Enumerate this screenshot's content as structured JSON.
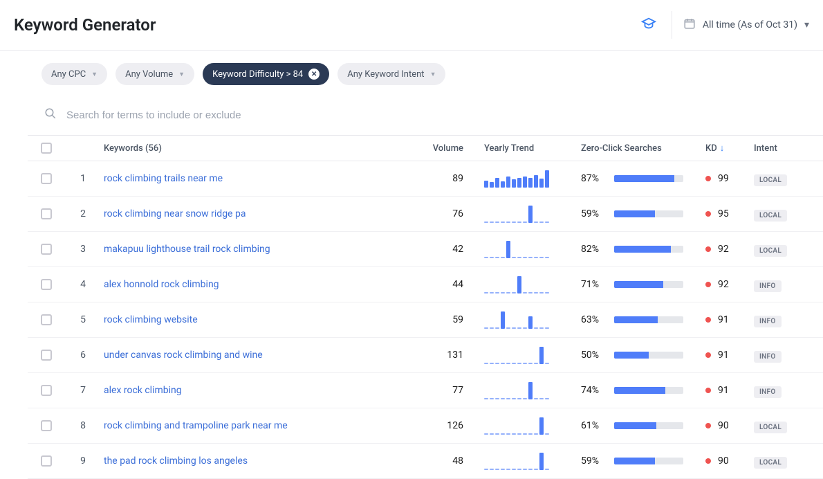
{
  "header": {
    "title": "Keyword Generator",
    "date_range": "All time (As of Oct 31)"
  },
  "filters": {
    "cpc": "Any CPC",
    "volume": "Any Volume",
    "difficulty": "Keyword Difficulty > 84",
    "intent": "Any Keyword Intent"
  },
  "search": {
    "placeholder": "Search for terms to include or exclude"
  },
  "columns": {
    "keywords": "Keywords (56)",
    "volume": "Volume",
    "trend": "Yearly Trend",
    "zero": "Zero-Click Searches",
    "kd": "KD",
    "intent": "Intent"
  },
  "rows": [
    {
      "n": 1,
      "keyword": "rock climbing trails near me",
      "volume": 89,
      "zero_pct": 87,
      "kd": 99,
      "intent": "LOCAL",
      "trend": [
        40,
        30,
        52,
        35,
        60,
        48,
        52,
        60,
        55,
        70,
        50,
        95
      ]
    },
    {
      "n": 2,
      "keyword": "rock climbing near snow ridge pa",
      "volume": 76,
      "zero_pct": 59,
      "kd": 95,
      "intent": "LOCAL",
      "trend": [
        0,
        0,
        0,
        0,
        0,
        0,
        0,
        0,
        95,
        0,
        0,
        0
      ]
    },
    {
      "n": 3,
      "keyword": "makapuu lighthouse trail rock climbing",
      "volume": 42,
      "zero_pct": 82,
      "kd": 92,
      "intent": "LOCAL",
      "trend": [
        0,
        0,
        0,
        0,
        95,
        0,
        0,
        0,
        0,
        0,
        0,
        0
      ]
    },
    {
      "n": 4,
      "keyword": "alex honnold rock climbing",
      "volume": 44,
      "zero_pct": 71,
      "kd": 92,
      "intent": "INFO",
      "trend": [
        0,
        0,
        0,
        0,
        0,
        0,
        95,
        0,
        0,
        0,
        0,
        0
      ]
    },
    {
      "n": 5,
      "keyword": "rock climbing website",
      "volume": 59,
      "zero_pct": 63,
      "kd": 91,
      "intent": "INFO",
      "trend": [
        0,
        0,
        0,
        95,
        0,
        0,
        0,
        0,
        70,
        0,
        0,
        0
      ]
    },
    {
      "n": 6,
      "keyword": "under canvas rock climbing and wine",
      "volume": 131,
      "zero_pct": 50,
      "kd": 91,
      "intent": "INFO",
      "trend": [
        0,
        0,
        0,
        0,
        0,
        0,
        0,
        0,
        0,
        0,
        95,
        0
      ]
    },
    {
      "n": 7,
      "keyword": "alex rock climbing",
      "volume": 77,
      "zero_pct": 74,
      "kd": 91,
      "intent": "INFO",
      "trend": [
        0,
        0,
        0,
        0,
        0,
        0,
        0,
        0,
        95,
        0,
        0,
        0
      ]
    },
    {
      "n": 8,
      "keyword": "rock climbing and trampoline park near me",
      "volume": 126,
      "zero_pct": 61,
      "kd": 90,
      "intent": "LOCAL",
      "trend": [
        0,
        0,
        0,
        0,
        0,
        0,
        0,
        0,
        0,
        0,
        95,
        0
      ]
    },
    {
      "n": 9,
      "keyword": "the pad rock climbing los angeles",
      "volume": 48,
      "zero_pct": 59,
      "kd": 90,
      "intent": "LOCAL",
      "trend": [
        0,
        0,
        0,
        0,
        0,
        0,
        0,
        0,
        0,
        0,
        95,
        0
      ]
    }
  ]
}
